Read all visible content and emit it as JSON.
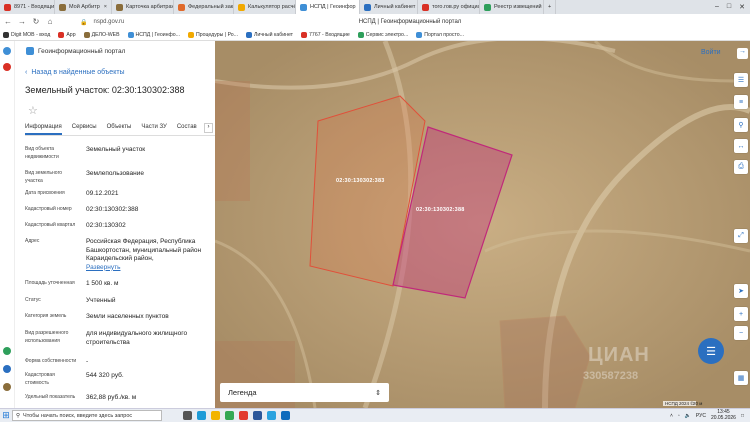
{
  "browser": {
    "tabs": [
      {
        "label": "8971 - Входящие",
        "color": "#d93025",
        "active": false
      },
      {
        "label": "Мой Арбитр",
        "color": "#8a6d3b",
        "active": false
      },
      {
        "label": "Карточка арбитраж",
        "color": "#8a6d3b",
        "active": false
      },
      {
        "label": "Федеральный закон",
        "color": "#e06a2b",
        "active": false
      },
      {
        "label": "Калькулятор расчёт",
        "color": "#f2a900",
        "active": false
      },
      {
        "label": "НСПД | Геоинфор",
        "color": "#3f8fd6",
        "active": true
      },
      {
        "label": "Личный кабинет",
        "color": "#2b6fc0",
        "active": false
      },
      {
        "label": "того.гов.ру официал",
        "color": "#d93025",
        "active": false
      },
      {
        "label": "Реестр извещений",
        "color": "#2e9f5b",
        "active": false
      }
    ],
    "url": "nspd.gov.ru",
    "page_title": "НСПД | Геоинформационный портал",
    "bookmarks": [
      {
        "label": "Digit МОВ - вход",
        "color": "#333333"
      },
      {
        "label": "App",
        "color": "#d93025"
      },
      {
        "label": "ДЕЛО-WEB",
        "color": "#8a6d3b"
      },
      {
        "label": "НСПД | Геоинфо...",
        "color": "#3f8fd6"
      },
      {
        "label": "Процедуры | Ро...",
        "color": "#f2a900"
      },
      {
        "label": "Личный кабинет",
        "color": "#2b6fc0"
      },
      {
        "label": "7767 - Входящие",
        "color": "#d93025"
      },
      {
        "label": "Сервис электро...",
        "color": "#2e9f5b"
      },
      {
        "label": "Портал просто...",
        "color": "#3f8fd6"
      }
    ]
  },
  "portal": {
    "name": "Геоинформационный портал",
    "back_label": "Назад в найденные объекты",
    "object_title": "Земельный участок: 02:30:130302:388",
    "tabs": [
      "Информация",
      "Сервисы",
      "Объекты",
      "Части ЗУ",
      "Состав"
    ],
    "fields": [
      {
        "label": "Вид объекта недвижимости",
        "value": "Земельный участок"
      },
      {
        "label": "Вид земельного участка",
        "value": "Землепользование"
      },
      {
        "label": "Дата присвоения",
        "value": "09.12.2021"
      },
      {
        "label": "Кадастровый номер",
        "value": "02:30:130302:388"
      },
      {
        "label": "Кадастровый квартал",
        "value": "02:30:130302"
      },
      {
        "label": "Адрес",
        "value": "Российская Федерация, Республика Башкортостан, муниципальный район Караидельский район,",
        "link": "Развернуть"
      },
      {
        "label": "Площадь уточненная",
        "value": "1 500 кв. м"
      },
      {
        "label": "Статус",
        "value": "Учтенный"
      },
      {
        "label": "Категория земель",
        "value": "Земли населенных пунктов"
      },
      {
        "label": "Вид разрешенного использования",
        "value": "для индивидуального жилищного строительства"
      },
      {
        "label": "Форма собственности",
        "value": "-"
      },
      {
        "label": "Кадастровая стоимость",
        "value": "544 320 руб."
      },
      {
        "label": "Удельный показатель",
        "value": "362,88 руб./кв. м"
      }
    ]
  },
  "map": {
    "login_label": "Войти",
    "legend_label": "Легенда",
    "parcel_labels": [
      "02:30:130302:383",
      "02:30:130302:388"
    ],
    "watermark": "ЦИАН",
    "watermark_id": "330587238",
    "attribution": "НСПД 2024 ©",
    "scale": "20 м"
  },
  "taskbar": {
    "search_placeholder": "Чтобы начать поиск, введите здесь запрос",
    "language": "РУС",
    "time": "13:45",
    "date": "20.05.2026",
    "apps": [
      {
        "name": "task-view",
        "color": "#555555"
      },
      {
        "name": "edge",
        "color": "#1e9bd7"
      },
      {
        "name": "explorer",
        "color": "#f2b400"
      },
      {
        "name": "chrome",
        "color": "#34a853"
      },
      {
        "name": "yandex",
        "color": "#e23a2e"
      },
      {
        "name": "word",
        "color": "#2b579a"
      },
      {
        "name": "telegram",
        "color": "#2aa3df"
      },
      {
        "name": "mail",
        "color": "#0f6cbd"
      }
    ]
  },
  "colors": {
    "accent": "#2b6fc0",
    "parcel_selected": "#c0287a",
    "parcel_neighbor": "#e0503a"
  }
}
